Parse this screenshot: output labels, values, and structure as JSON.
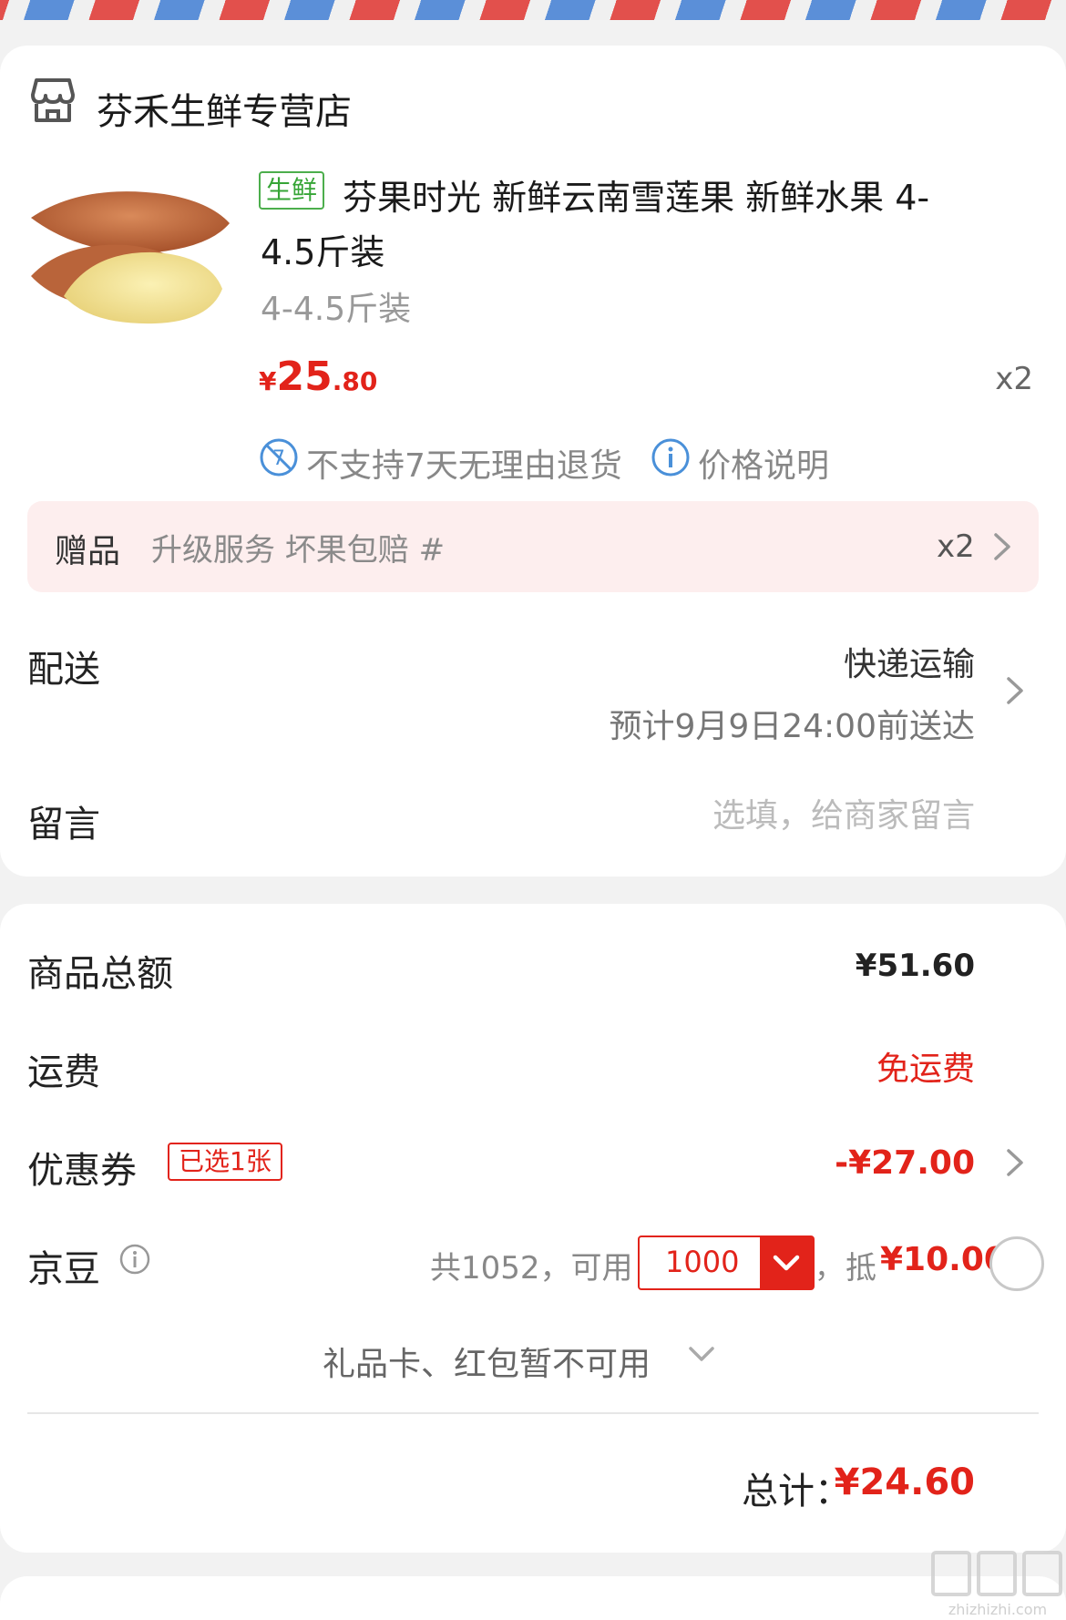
{
  "theme": {
    "accent": "#e2231a",
    "fresh_green": "#36a536",
    "gift_bg": "#fdeeee"
  },
  "store": {
    "name": "芬禾生鲜专营店",
    "icon": "store-icon"
  },
  "product": {
    "tag": "生鲜",
    "title_line1": "芬果时光 新鲜云南雪莲果 新鲜水果 4-",
    "title_line2": "4.5斤装",
    "spec": "4-4.5斤装",
    "price_currency": "¥",
    "price_int": "25",
    "price_dec": ".80",
    "quantity": "x2",
    "service_note": "不支持7天无理由退货",
    "price_explain": "价格说明"
  },
  "gift": {
    "label": "赠品",
    "description": "升级服务 坏果包赔 #",
    "quantity": "x2"
  },
  "delivery": {
    "label": "配送",
    "method": "快递运输",
    "eta": "预计9月9日24:00前送达"
  },
  "message": {
    "label": "留言",
    "placeholder": "选填，给商家留言",
    "value": ""
  },
  "summary": {
    "subtotal_label": "商品总额",
    "subtotal_value": "¥51.60",
    "shipping_label": "运费",
    "shipping_value": "免运费",
    "coupon_label": "优惠券",
    "coupon_badge": "已选1张",
    "coupon_value": "-¥27.00",
    "jd_label": "京豆",
    "jd_total": "共1052，可用",
    "jd_selected": "1000",
    "jd_comma": "，",
    "jd_deduct_label": "抵",
    "jd_deduct_value": "¥10.00",
    "jd_checked": false,
    "giftcard_note": "礼品卡、红包暂不可用",
    "total_label": "总计：",
    "total_value": "¥24.60"
  },
  "watermark": "zhizhizhi.com"
}
